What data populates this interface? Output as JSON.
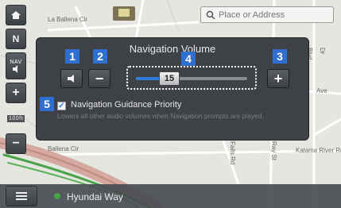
{
  "map": {
    "labels": [
      "La Ballena Cir",
      "Ballena Cir",
      "Kalama River Rd",
      "Ave",
      "Dr",
      "Blvd",
      "Ray St",
      "Falls Rd"
    ]
  },
  "search": {
    "placeholder": "Place or Address",
    "icon": "search-icon"
  },
  "side_buttons": [
    {
      "name": "home",
      "icon": "home-icon"
    },
    {
      "name": "north-up",
      "label": "N"
    },
    {
      "name": "nav-volume",
      "label": "NAV"
    },
    {
      "name": "zoom-in",
      "label": "+"
    },
    {
      "name": "scale",
      "label": "100ft"
    },
    {
      "name": "zoom-out",
      "label": "−"
    }
  ],
  "dialog": {
    "title": "Navigation Volume",
    "mute_icon": "speaker-icon",
    "minus_label": "−",
    "plus_label": "+",
    "volume": 15,
    "volume_fraction": 0.3,
    "guidance_checked": true,
    "guidance_label": "Navigation Guidance Priority",
    "guidance_desc": "Lowers all other audio volumes when Navigation prompts are played."
  },
  "callouts": [
    "1",
    "2",
    "3",
    "4",
    "5"
  ],
  "bottom_bar": {
    "menu_icon": "menu-icon",
    "road": "Hyundai Way"
  },
  "colors": {
    "accent": "#2f6fd2",
    "dialog_bg": "#30343a",
    "road_green": "#4aa34a",
    "highway": "#c08a80"
  }
}
